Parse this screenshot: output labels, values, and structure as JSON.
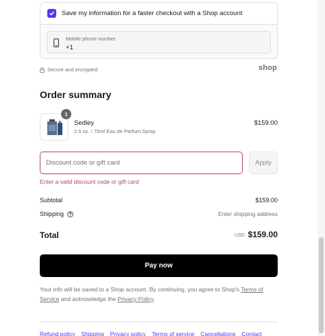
{
  "shop_pay": {
    "save_info_label": "Save my information for a faster checkout with a Shop account",
    "save_checked": true,
    "phone_label": "Mobile phone number",
    "phone_value": "+1",
    "secure_text": "Secure and encrypted",
    "logo_text": "shop"
  },
  "order_summary": {
    "title": "Order summary",
    "product": {
      "quantity": "1",
      "name": "Sedley",
      "variant": "2.5 oz. / 75ml Eau de Parfum Spray",
      "price": "$159.00"
    },
    "discount": {
      "placeholder": "Discount code or gift card",
      "value": "",
      "apply_label": "Apply",
      "error": "Enter a valid discount code or gift card"
    },
    "subtotal_label": "Subtotal",
    "subtotal_value": "$159.00",
    "shipping_label": "Shipping",
    "shipping_value": "Enter shipping address",
    "total_label": "Total",
    "total_currency": "USD",
    "total_value": "$159.00"
  },
  "pay_button_label": "Pay now",
  "consent": {
    "text_before": "Your info will be saved to a Shop account. By continuing, you agree to Shop's ",
    "terms_link": "Terms of Service",
    "text_middle": " and acknowledge the ",
    "privacy_link": "Privacy Policy",
    "text_after": "."
  },
  "footer_links": [
    "Refund policy",
    "Shipping",
    "Privacy policy",
    "Terms of service",
    "Cancellations",
    "Contact"
  ],
  "colors": {
    "accent": "#5a31f4",
    "error": "#b34566",
    "pay_button": "#000000"
  },
  "icons": {
    "checkbox": "checkmark-icon",
    "phone": "mobile-phone-icon",
    "lock": "lock-icon",
    "help": "question-circle-icon"
  }
}
